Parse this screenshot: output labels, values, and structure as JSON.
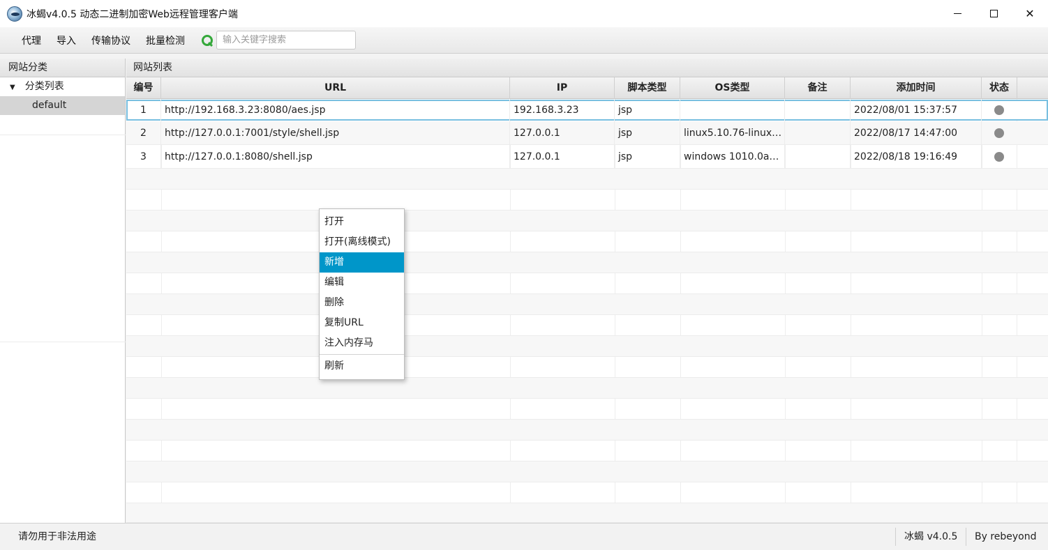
{
  "window": {
    "title": "冰蝎v4.0.5 动态二进制加密Web远程管理客户端",
    "icon": "ice-scorpion-logo-icon",
    "controls": {
      "minimize": "minimize-icon",
      "maximize": "maximize-icon",
      "close": "✕"
    }
  },
  "menubar": {
    "items": [
      "代理",
      "导入",
      "传输协议",
      "批量检测"
    ],
    "search": {
      "icon": "search-icon",
      "placeholder": "输入关键字搜索",
      "value": ""
    }
  },
  "sidebar": {
    "header": "网站分类",
    "tree": {
      "root_label": "分类列表",
      "expanded_icon": "▼",
      "children": [
        "default"
      ]
    }
  },
  "site_list": {
    "header": "网站列表",
    "columns": [
      "编号",
      "URL",
      "IP",
      "脚本类型",
      "OS类型",
      "备注",
      "添加时间",
      "状态"
    ],
    "rows": [
      {
        "id": "1",
        "url": "http://192.168.3.23:8080/aes.jsp",
        "ip": "192.168.3.23",
        "script": "jsp",
        "os": "",
        "note": "",
        "time": "2022/08/01 15:37:57",
        "status": "gray"
      },
      {
        "id": "2",
        "url": "http://127.0.0.1:7001/style/shell.jsp",
        "ip": "127.0.0.1",
        "script": "jsp",
        "os": "linux5.10.76-linux…",
        "note": "",
        "time": "2022/08/17 14:47:00",
        "status": "gray"
      },
      {
        "id": "3",
        "url": "http://127.0.0.1:8080/shell.jsp",
        "ip": "127.0.0.1",
        "script": "jsp",
        "os": "windows 1010.0a…",
        "note": "",
        "time": "2022/08/18 19:16:49",
        "status": "gray"
      }
    ],
    "selected_row": 1
  },
  "context_menu": {
    "items": [
      "打开",
      "打开(离线模式)",
      "新增",
      "编辑",
      "删除",
      "复制URL",
      "注入内存马"
    ],
    "footer_item": "刷新",
    "highlighted": "新增"
  },
  "statusbar": {
    "notice": "请勿用于非法用途",
    "version": "冰蝎 v4.0.5",
    "author": "By rebeyond"
  },
  "colors": {
    "accent": "#0096c9",
    "selection_outline": "#79bfe0",
    "status_offline": "#8a8a8a",
    "search_icon": "#34a83a"
  }
}
